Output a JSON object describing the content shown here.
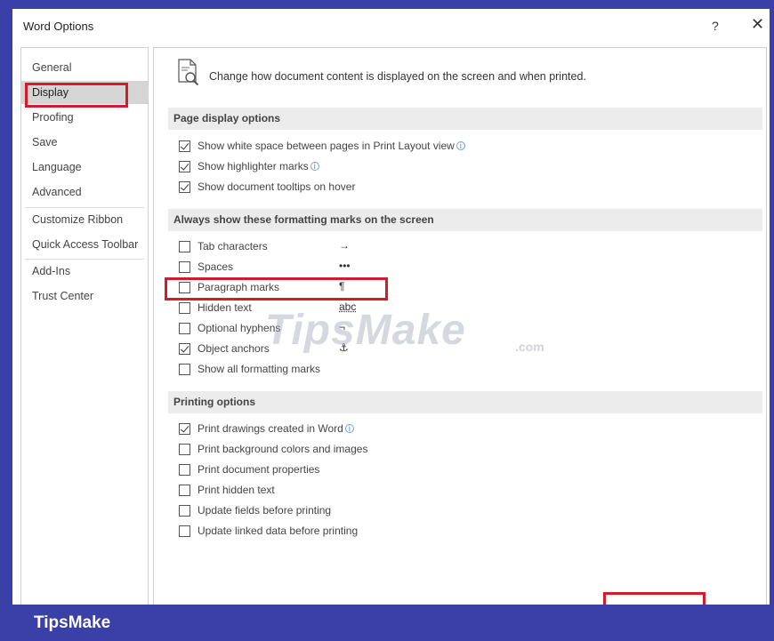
{
  "window": {
    "title": "Word Options",
    "help_label": "?",
    "close_label": "✕"
  },
  "nav": {
    "items": [
      {
        "label": "General"
      },
      {
        "label": "Display"
      },
      {
        "label": "Proofing"
      },
      {
        "label": "Save"
      },
      {
        "label": "Language"
      },
      {
        "label": "Advanced"
      },
      {
        "label": "Customize Ribbon"
      },
      {
        "label": "Quick Access Toolbar"
      },
      {
        "label": "Add-Ins"
      },
      {
        "label": "Trust Center"
      }
    ],
    "selected": "Display"
  },
  "content": {
    "intro": "Change how document content is displayed on the screen and when printed.",
    "page_display": {
      "header": "Page display options",
      "options": [
        {
          "label": "Show white space between pages in Print Layout view",
          "checked": true,
          "info": true
        },
        {
          "label": "Show highlighter marks",
          "checked": true,
          "info": true
        },
        {
          "label": "Show document tooltips on hover",
          "checked": true,
          "info": false
        }
      ]
    },
    "formatting_marks": {
      "header": "Always show these formatting marks on the screen",
      "options": [
        {
          "label": "Tab characters",
          "checked": false,
          "glyph": "→"
        },
        {
          "label": "Spaces",
          "checked": false,
          "glyph": "•••"
        },
        {
          "label": "Paragraph marks",
          "checked": false,
          "glyph": "¶"
        },
        {
          "label": "Hidden text",
          "checked": false,
          "glyph": "abc"
        },
        {
          "label": "Optional hyphens",
          "checked": false,
          "glyph": "¬"
        },
        {
          "label": "Object anchors",
          "checked": true,
          "glyph": "⚓"
        },
        {
          "label": "Show all formatting marks",
          "checked": false,
          "glyph": ""
        }
      ]
    },
    "printing": {
      "header": "Printing options",
      "options": [
        {
          "label": "Print drawings created in Word",
          "checked": true,
          "info": true
        },
        {
          "label": "Print background colors and images",
          "checked": false,
          "info": false
        },
        {
          "label": "Print document properties",
          "checked": false,
          "info": false
        },
        {
          "label": "Print hidden text",
          "checked": false,
          "info": false
        },
        {
          "label": "Update fields before printing",
          "checked": false,
          "info": false
        },
        {
          "label": "Update linked data before printing",
          "checked": false,
          "info": false
        }
      ]
    }
  },
  "info_glyph": "i",
  "watermark": {
    "text": "TipsMake",
    "suffix": ".com"
  },
  "brand": {
    "text": "TipsMake"
  },
  "colors": {
    "frame": "#3b3fa8",
    "highlight_box": "#d21c2c",
    "section_bg": "#ececec",
    "selected_nav": "#d5d5d5"
  }
}
